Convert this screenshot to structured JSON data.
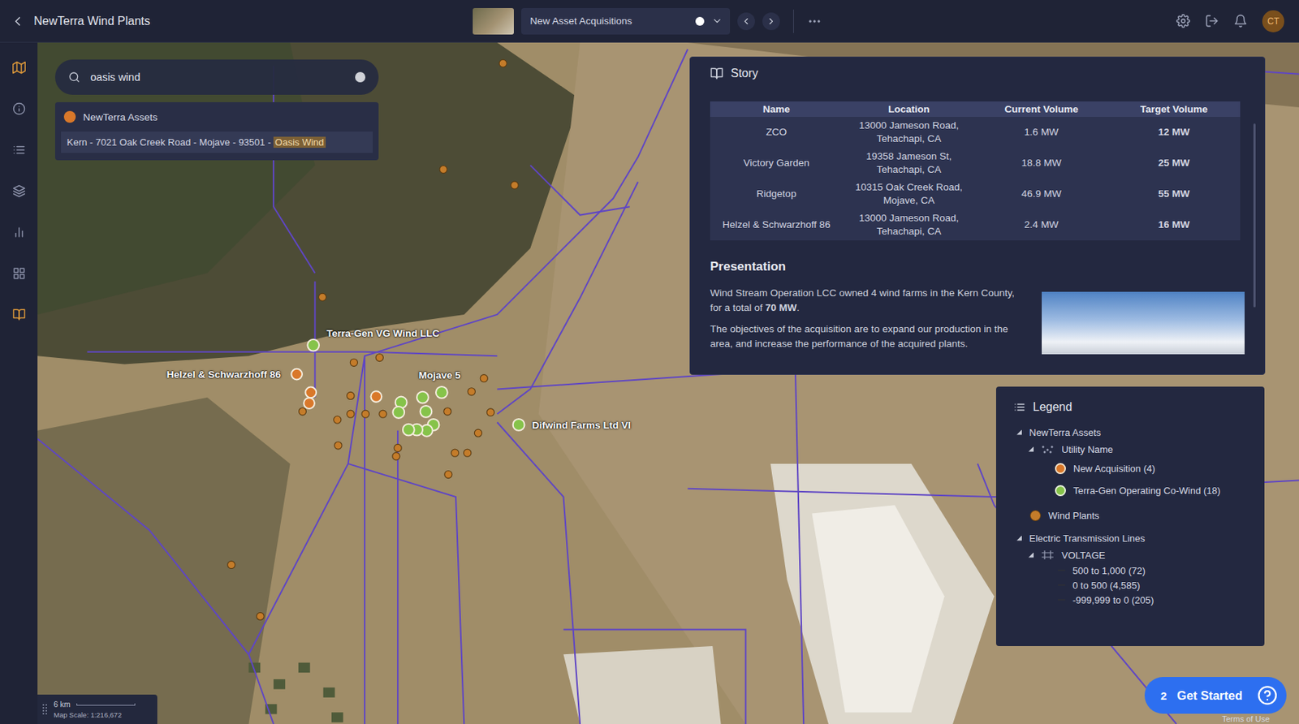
{
  "header": {
    "title": "NewTerra Wind Plants",
    "story_selector": {
      "label": "New Asset Acquisitions"
    },
    "avatar": "CT"
  },
  "sidebar": {
    "items": [
      {
        "selected": true
      },
      {
        "selected": false
      },
      {
        "selected": false
      },
      {
        "selected": false
      },
      {
        "selected": false
      },
      {
        "selected": false
      },
      {
        "selected": true
      }
    ]
  },
  "search": {
    "value": "oasis wind",
    "results": {
      "group": "NewTerra Assets",
      "color": "#d9782a",
      "items": [
        {
          "text": "Kern - 7021 Oak Creek Road - Mojave - 93501 - ",
          "match": "Oasis Wind",
          "selected": true
        }
      ]
    }
  },
  "story": {
    "title": "Story",
    "table": {
      "columns": [
        "Name",
        "Location",
        "Current Volume",
        "Target Volume"
      ],
      "rows": [
        [
          "ZCO",
          "13000 Jameson Road, Tehachapi, CA",
          "1.6 MW",
          "12 MW"
        ],
        [
          "Victory Garden",
          "19358 Jameson St, Tehachapi, CA",
          "18.8 MW",
          "25 MW"
        ],
        [
          "Ridgetop",
          "10315 Oak Creek Road, Mojave, CA",
          "46.9 MW",
          "55 MW"
        ],
        [
          "Helzel & Schwarzhoff 86",
          "13000 Jameson Road, Tehachapi, CA",
          "2.4 MW",
          "16 MW"
        ]
      ]
    },
    "presentation": {
      "title": "Presentation",
      "paragraphs": [
        [
          {
            "text": "Wind Stream Operation LCC owned 4 wind farms in the Kern County, for a total of ",
            "bold": false
          },
          {
            "text": "70 MW",
            "bold": true
          },
          {
            "text": ".",
            "bold": false
          }
        ],
        [
          {
            "text": "The objectives of the acquisition are to expand our production in the area, and increase the performance of the acquired plants.",
            "bold": false
          }
        ]
      ]
    }
  },
  "map": {
    "labels": [
      "Terra-Gen VG Wind LLC",
      "Helzel & Schwarzhoff 86",
      "Mojave 5",
      "Difwind Farms Ltd VI"
    ],
    "pins": [
      {
        "kind": "wind"
      },
      {
        "kind": "wind"
      },
      {
        "kind": "wind"
      },
      {
        "kind": "wind"
      },
      {
        "kind": "wind"
      },
      {
        "kind": "wind"
      },
      {
        "kind": "wind"
      },
      {
        "kind": "wind"
      },
      {
        "kind": "wind"
      },
      {
        "kind": "wind"
      },
      {
        "kind": "wind"
      },
      {
        "kind": "wind"
      },
      {
        "kind": "wind"
      },
      {
        "kind": "wind"
      },
      {
        "kind": "wind"
      },
      {
        "kind": "wind"
      },
      {
        "kind": "wind"
      },
      {
        "kind": "wind"
      },
      {
        "kind": "wind"
      },
      {
        "kind": "wind"
      },
      {
        "kind": "wind"
      },
      {
        "kind": "wind"
      },
      {
        "kind": "wind"
      },
      {
        "kind": "wind"
      },
      {
        "kind": "wind"
      },
      {
        "kind": "terra-gen"
      },
      {
        "kind": "terra-gen"
      },
      {
        "kind": "terra-gen"
      },
      {
        "kind": "terra-gen"
      },
      {
        "kind": "terra-gen"
      },
      {
        "kind": "terra-gen"
      },
      {
        "kind": "terra-gen"
      },
      {
        "kind": "terra-gen"
      },
      {
        "kind": "terra-gen"
      },
      {
        "kind": "terra-gen"
      },
      {
        "kind": "terra-gen"
      },
      {
        "kind": "acquisition"
      },
      {
        "kind": "acquisition"
      },
      {
        "kind": "acquisition"
      },
      {
        "kind": "acquisition"
      }
    ],
    "scale": {
      "distance": "6 km",
      "text": "Map Scale: 1:216,672"
    }
  },
  "legend": {
    "title": "Legend",
    "layers": [
      {
        "label": "NewTerra Assets",
        "kind": "group",
        "expanded": true,
        "fields": [
          {
            "label": "Utility Name",
            "expanded": true,
            "classes": [
              {
                "label": "New Acquisition (4)",
                "color": "#d9782a",
                "kind": "ring"
              },
              {
                "label": "Terra-Gen Operating Co-Wind (18)",
                "color": "#86c34a",
                "kind": "dot"
              }
            ]
          }
        ]
      },
      {
        "label": "Wind Plants",
        "kind": "point",
        "color": "#c47c2a"
      },
      {
        "label": "Electric Transmission Lines",
        "kind": "group",
        "expanded": true,
        "fields": [
          {
            "label": "VOLTAGE",
            "expanded": true,
            "classes": [
              {
                "label": "500 to 1,000 (72)",
                "color": "#2b2d38",
                "kind": "line"
              },
              {
                "label": "0 to 500 (4,585)",
                "color": "#2b2d38",
                "kind": "line"
              },
              {
                "label": "-999,999 to 0 (205)",
                "color": "#2b2d38",
                "kind": "line"
              }
            ]
          }
        ]
      }
    ]
  },
  "footer": {
    "get_started": {
      "count": "2",
      "label": "Get Started"
    },
    "terms": "Terms of Use"
  }
}
